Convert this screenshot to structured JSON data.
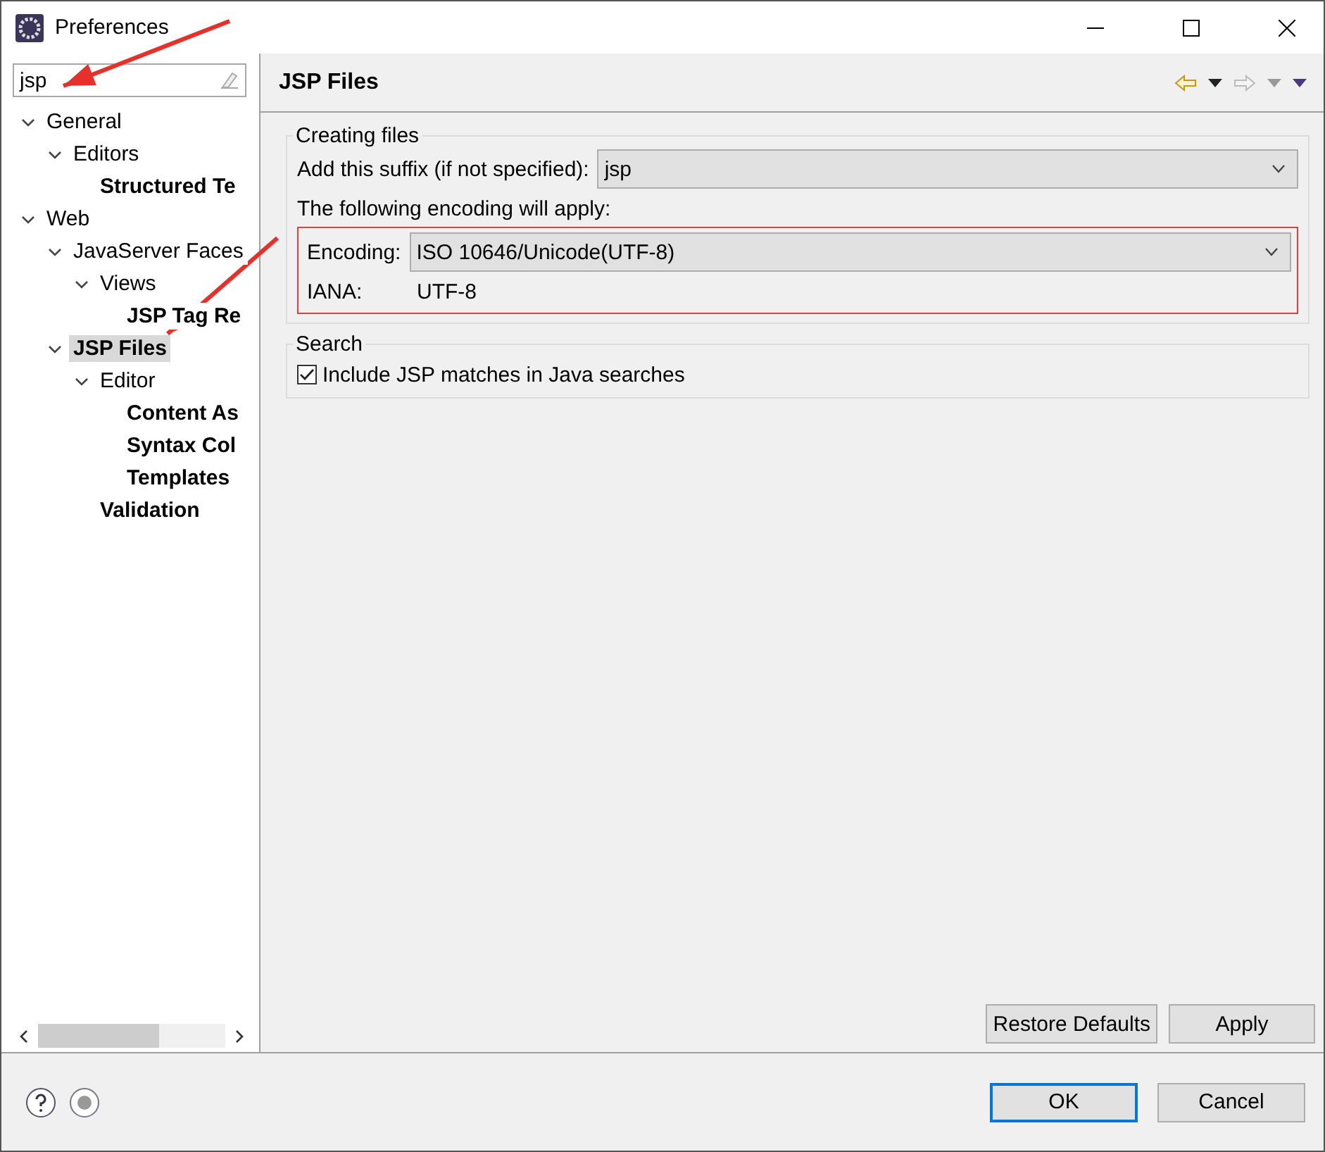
{
  "window": {
    "title": "Preferences"
  },
  "filter": {
    "value": "jsp"
  },
  "tree": [
    {
      "label": "General",
      "bold": false,
      "selected": false,
      "expanded": true,
      "children": [
        {
          "label": "Editors",
          "bold": false,
          "selected": false,
          "expanded": true,
          "children": [
            {
              "label": "Structured Te",
              "bold": true,
              "selected": false
            }
          ]
        }
      ]
    },
    {
      "label": "Web",
      "bold": false,
      "selected": false,
      "expanded": true,
      "children": [
        {
          "label": "JavaServer Faces",
          "bold": false,
          "selected": false,
          "expanded": true,
          "children": [
            {
              "label": "Views",
              "bold": false,
              "selected": false,
              "expanded": true,
              "children": [
                {
                  "label": "JSP Tag Re",
                  "bold": true,
                  "selected": false
                }
              ]
            }
          ]
        },
        {
          "label": "JSP Files",
          "bold": true,
          "selected": true,
          "expanded": true,
          "children": [
            {
              "label": "Editor",
              "bold": false,
              "selected": false,
              "expanded": true,
              "children": [
                {
                  "label": "Content As",
                  "bold": true,
                  "selected": false
                },
                {
                  "label": "Syntax Col",
                  "bold": true,
                  "selected": false
                },
                {
                  "label": "Templates",
                  "bold": true,
                  "selected": false
                }
              ]
            },
            {
              "label": "Validation",
              "bold": true,
              "selected": false
            }
          ]
        }
      ]
    }
  ],
  "page": {
    "title": "JSP Files",
    "creating_files": {
      "title": "Creating files",
      "suffix_label": "Add this suffix (if not specified):",
      "suffix_value": "jsp",
      "encoding_note": "The following encoding will apply:",
      "encoding_group": {
        "highlighted": true,
        "encoding_label": "Encoding:",
        "encoding_value": "ISO 10646/Unicode(UTF-8)",
        "iana_label": "IANA:",
        "iana_value": "UTF-8"
      }
    },
    "search": {
      "title": "Search",
      "checkbox": {
        "label": "Include JSP matches in Java searches",
        "checked": true
      }
    },
    "buttons": [
      "Restore Defaults",
      "Apply"
    ]
  },
  "dialog_buttons": [
    {
      "label": "OK",
      "default": true
    },
    {
      "label": "Cancel",
      "default": false
    }
  ],
  "annotations": [
    {
      "kind": "arrow"
    },
    {
      "kind": "arrow"
    }
  ]
}
